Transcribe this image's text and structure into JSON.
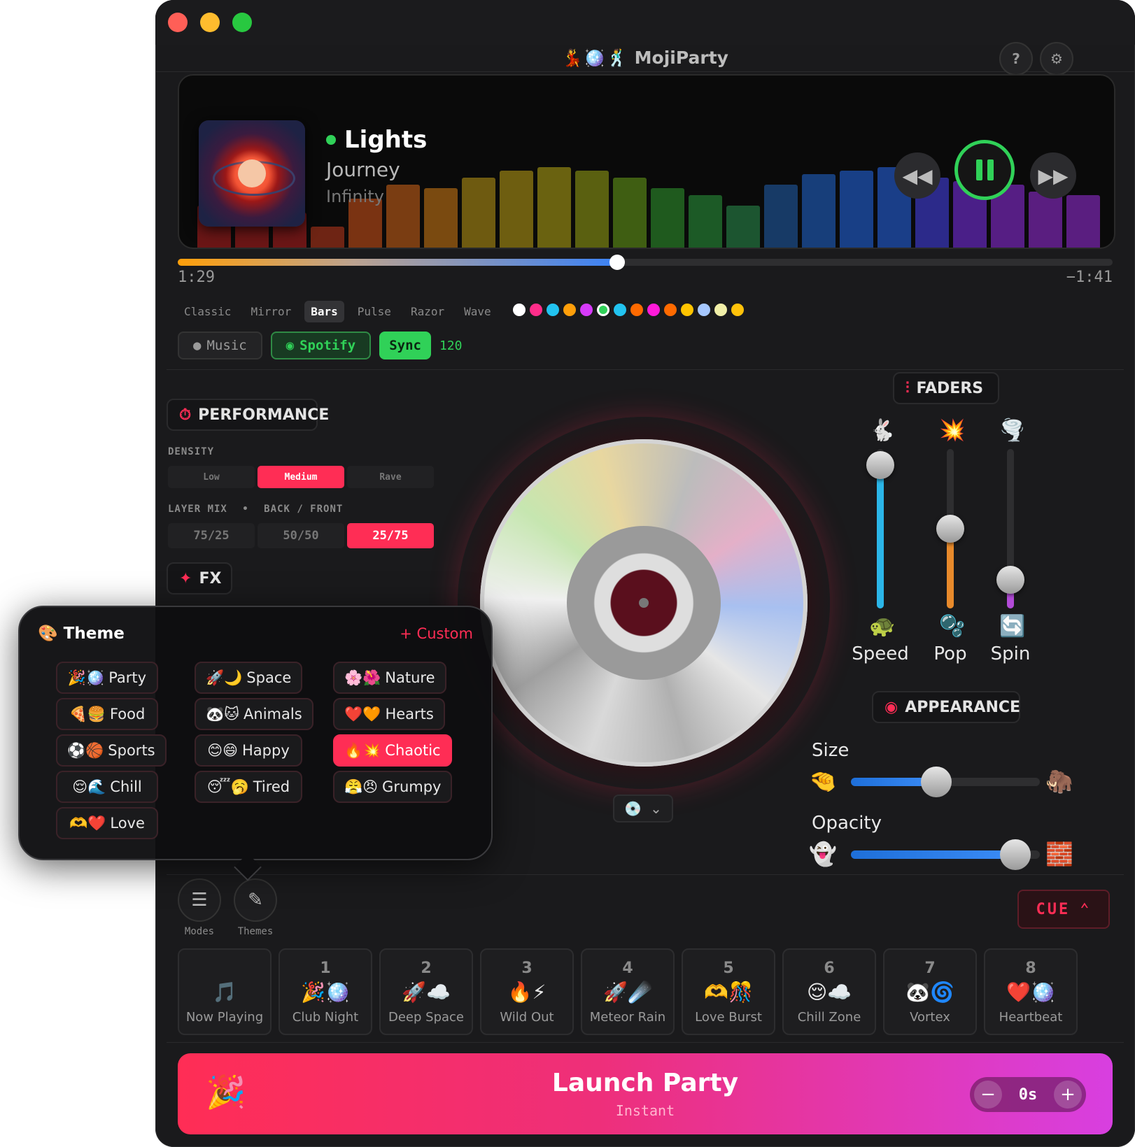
{
  "app": {
    "title": "MojiParty",
    "title_emoji": "💃🪩🕺",
    "help_icon": "question-icon",
    "settings_icon": "gear-icon"
  },
  "now_playing": {
    "title": "Lights",
    "artist": "Journey",
    "album": "Infinity",
    "status_color": "#30d158",
    "elapsed": "1:29",
    "remaining": "−1:41",
    "progress": 0.47
  },
  "visualizer": {
    "modes": [
      "Classic",
      "Mirror",
      "Bars",
      "Pulse",
      "Razor",
      "Wave"
    ],
    "active_mode": "Bars",
    "swatches": [
      "#ffffff",
      "#ff2d8a",
      "#22c3f0",
      "#ff9f0a",
      "#d63af9",
      "#30d158",
      "#22c3f0",
      "#ff6a00",
      "#ff1ad9",
      "#ff6a00",
      "#ffc400",
      "#a6c8ff",
      "#f1efa8",
      "#ffc20a"
    ],
    "selected_swatch": 5
  },
  "source": {
    "music_label": "Music",
    "spotify_label": "Spotify",
    "sync_label": "Sync",
    "bpm": "120"
  },
  "performance": {
    "title": "PERFORMANCE",
    "density_label": "DENSITY",
    "density_options": [
      "Low",
      "Medium",
      "Rave"
    ],
    "density_selected": 1,
    "layer_mix_label": "LAYER MIX",
    "layer_mix_sub": "BACK / FRONT",
    "layer_options": [
      "75/25",
      "50/50",
      "25/75"
    ],
    "layer_selected": 2
  },
  "fx": {
    "title": "FX"
  },
  "theme_popover": {
    "title": "Theme",
    "title_emoji": "🎨",
    "custom_label": "+ Custom",
    "chips": [
      {
        "emoji": "🎉🪩",
        "label": "Party"
      },
      {
        "emoji": "🚀🌙",
        "label": "Space"
      },
      {
        "emoji": "🌸🌺",
        "label": "Nature"
      },
      {
        "emoji": "🍕🍔",
        "label": "Food"
      },
      {
        "emoji": "🐼🐱",
        "label": "Animals"
      },
      {
        "emoji": "❤️🧡",
        "label": "Hearts"
      },
      {
        "emoji": "⚽🏀",
        "label": "Sports"
      },
      {
        "emoji": "😊😄",
        "label": "Happy"
      },
      {
        "emoji": "🔥💥",
        "label": "Chaotic"
      },
      {
        "emoji": "😌🌊",
        "label": "Chill"
      },
      {
        "emoji": "😴🥱",
        "label": "Tired"
      },
      {
        "emoji": "😤😠",
        "label": "Grumpy"
      },
      {
        "emoji": "🫶❤️",
        "label": "Love"
      }
    ],
    "selected": "Chaotic"
  },
  "disc_selector": {
    "emoji": "💿",
    "chevron": "chevron-down-icon"
  },
  "faders": {
    "title": "FADERS",
    "items": [
      {
        "label": "Speed",
        "top_emoji": "🐇",
        "bottom_emoji": "🐢",
        "value": 0.9,
        "color": "#2bb6e8"
      },
      {
        "label": "Pop",
        "top_emoji": "💥",
        "bottom_emoji": "🫧",
        "value": 0.5,
        "color": "#e88a2b"
      },
      {
        "label": "Spin",
        "top_emoji": "🌪️",
        "bottom_emoji": "🔄",
        "value": 0.18,
        "color": "#b34bd8"
      }
    ]
  },
  "appearance": {
    "title": "APPEARANCE",
    "size_label": "Size",
    "size_value": 0.45,
    "size_min_emoji": "🤏",
    "size_max_emoji": "🦣",
    "opacity_label": "Opacity",
    "opacity_value": 0.87,
    "opacity_min_emoji": "👻",
    "opacity_max_emoji": "🧱"
  },
  "toolbar": {
    "modes_label": "Modes",
    "themes_label": "Themes",
    "cue_label": "CUE"
  },
  "presets": [
    {
      "num": "",
      "emoji": "🎵",
      "name": "Now Playing"
    },
    {
      "num": "1",
      "emoji": "🎉🪩",
      "name": "Club Night"
    },
    {
      "num": "2",
      "emoji": "🚀☁️",
      "name": "Deep Space"
    },
    {
      "num": "3",
      "emoji": "🔥⚡",
      "name": "Wild Out"
    },
    {
      "num": "4",
      "emoji": "🚀☄️",
      "name": "Meteor Rain"
    },
    {
      "num": "5",
      "emoji": "🫶🎊",
      "name": "Love Burst"
    },
    {
      "num": "6",
      "emoji": "😌☁️",
      "name": "Chill Zone"
    },
    {
      "num": "7",
      "emoji": "🐼🌀",
      "name": "Vortex"
    },
    {
      "num": "8",
      "emoji": "❤️🪩",
      "name": "Heartbeat"
    }
  ],
  "launch": {
    "title": "Launch Party",
    "subtitle": "Instant",
    "emoji": "🎉",
    "delay": "0s"
  }
}
